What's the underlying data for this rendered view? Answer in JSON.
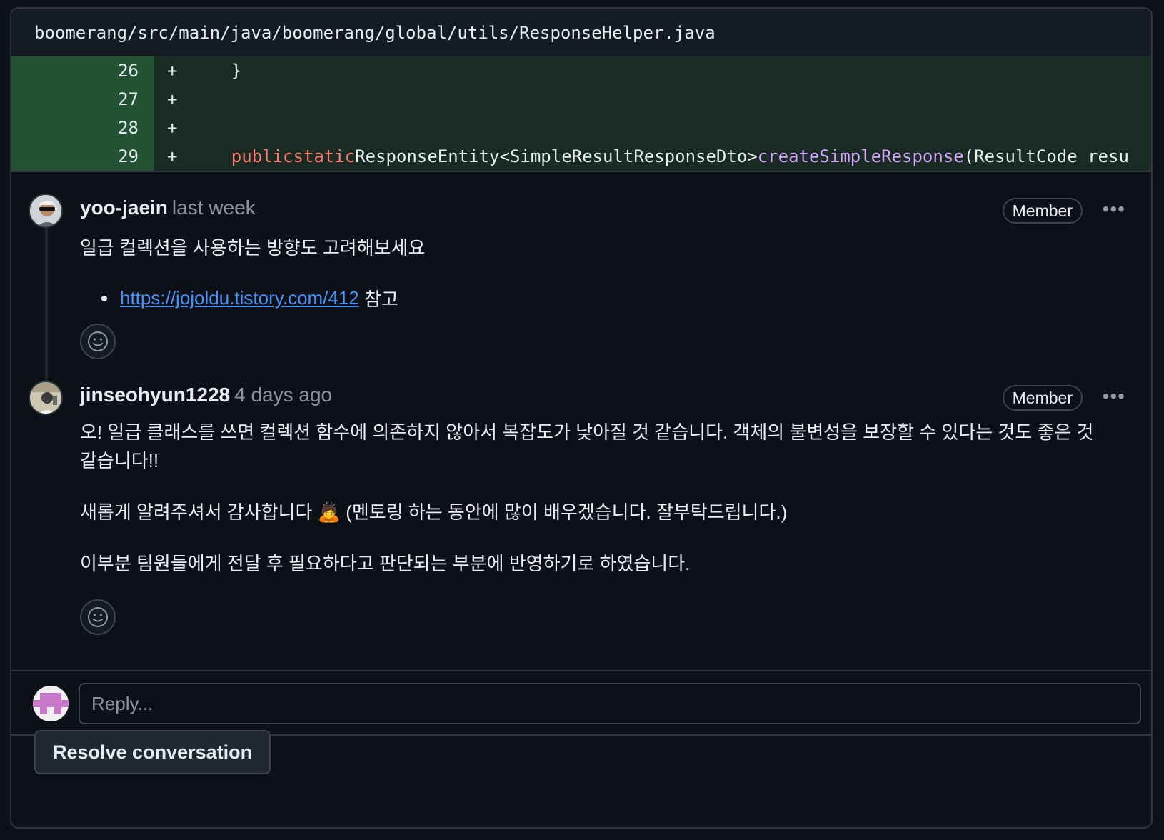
{
  "file": {
    "path": "boomerang/src/main/java/boomerang/global/utils/ResponseHelper.java"
  },
  "diff_lines": [
    {
      "num": "26",
      "sign": "+",
      "code": "    }"
    },
    {
      "num": "27",
      "sign": "+",
      "code": ""
    },
    {
      "num": "28",
      "sign": "+",
      "code": ""
    },
    {
      "num": "29",
      "sign": "+",
      "code_parts": {
        "indent": "    ",
        "kw1": "public",
        "kw2": "static",
        "type": "ResponseEntity<SimpleResultResponseDto>",
        "fn": "createSimpleResponse",
        "rest": "(ResultCode resu"
      }
    }
  ],
  "comments": [
    {
      "author": "yoo-jaein",
      "time": "last week",
      "badge": "Member",
      "text": "일급 컬렉션을 사용하는 방향도 고려해보세요",
      "bullet_link": "https://jojoldu.tistory.com/412",
      "bullet_suffix": " 참고"
    },
    {
      "author": "jinseohyun1228",
      "time": "4 days ago",
      "badge": "Member",
      "para1": "오! 일급 클래스를 쓰면 컬렉션 함수에 의존하지 않아서 복잡도가 낮아질 것 같습니다. 객체의 불변성을 보장할 수 있다는 것도 좋은 것 같습니다!!",
      "para2": "새롭게 알려주셔서 감사합니다 🙇 (멘토링 하는 동안에 많이 배우겠습니다. 잘부탁드립니다.)",
      "para3": "이부분 팀원들에게 전달 후 필요하다고 판단되는 부분에 반영하기로 하였습니다."
    }
  ],
  "kebab": "•••",
  "reply": {
    "placeholder": "Reply..."
  },
  "resolve_label": "Resolve conversation",
  "icons": {
    "react": "smiley-icon",
    "kebab": "kebab-horizontal-icon"
  },
  "colors": {
    "background": "#0d1117",
    "diff_added_num": "#235232",
    "diff_added_code": "#1a2b23",
    "keyword": "#ff7b72",
    "function": "#d2a8ff",
    "link": "#4493f8"
  }
}
